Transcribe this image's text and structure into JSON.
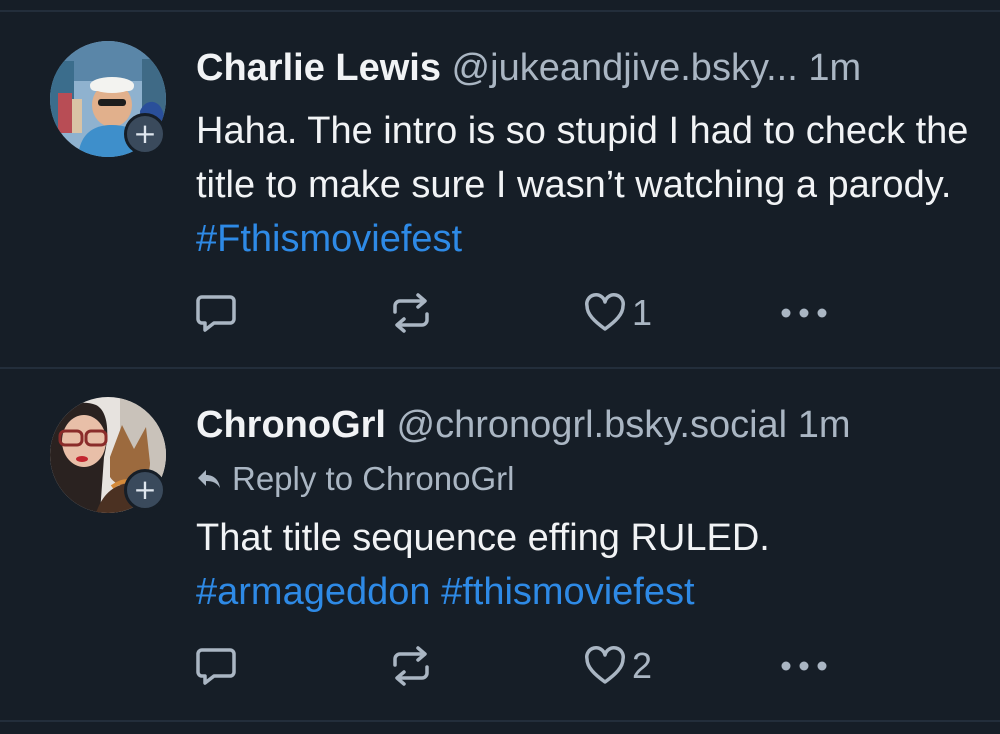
{
  "colors": {
    "background": "#161e27",
    "divider": "#232e3b",
    "text": "#f1f3f5",
    "muted": "#aab6c3",
    "hashtag": "#2e8ae6"
  },
  "posts": [
    {
      "author": {
        "name": "Charlie Lewis",
        "handle": "@jukeandjive.bsky...",
        "avatar": "avatar-photo",
        "follow_badge": "+"
      },
      "time": "1m",
      "body": {
        "text": "Haha. The intro is so stupid I had to check the title to make sure I wasn’t watching a parody. ",
        "hashtags": [
          "#Fthismoviefest"
        ]
      },
      "actions": {
        "reply_icon": "comment-icon",
        "repost_icon": "repost-icon",
        "like_icon": "heart-icon",
        "like_count": "1",
        "more_icon": "ellipsis-icon"
      }
    },
    {
      "author": {
        "name": "ChronoGrl",
        "handle": "@chronogrl.bsky.social",
        "avatar": "avatar-photo",
        "follow_badge": "+"
      },
      "time": "1m",
      "reply_to": "Reply to ChronoGrl",
      "body": {
        "text": "That title sequence effing RULED. ",
        "hashtags": [
          "#armageddon",
          "#fthismoviefest"
        ]
      },
      "actions": {
        "reply_icon": "comment-icon",
        "repost_icon": "repost-icon",
        "like_icon": "heart-icon",
        "like_count": "2",
        "more_icon": "ellipsis-icon"
      }
    }
  ]
}
